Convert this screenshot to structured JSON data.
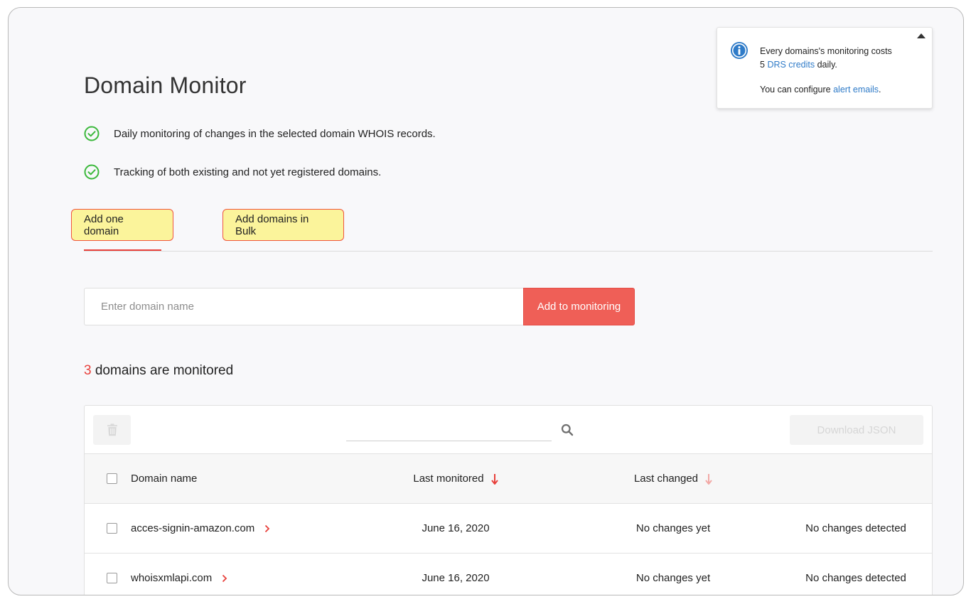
{
  "header": {
    "title": "Domain Monitor"
  },
  "features": [
    "Daily monitoring of changes in the selected domain WHOIS records.",
    "Tracking of both existing and not yet registered domains."
  ],
  "info_box": {
    "line1": "Every domains's monitoring costs",
    "cost_number": "5",
    "credits_link": "DRS credits",
    "cost_suffix": "daily.",
    "configure_prefix": "You can configure",
    "alert_link": "alert emails",
    "configure_suffix": "."
  },
  "tabs": [
    {
      "label": "Add one domain",
      "active": true
    },
    {
      "label": "Add domains in Bulk",
      "active": false
    }
  ],
  "domain_form": {
    "placeholder": "Enter domain name",
    "value": "",
    "submit_label": "Add to monitoring"
  },
  "summary": {
    "count": "3",
    "text": "domains are monitored"
  },
  "table": {
    "search_value": "",
    "download_label": "Download JSON",
    "columns": {
      "domain": "Domain name",
      "last_monitored": "Last monitored",
      "last_changed": "Last changed"
    },
    "rows": [
      {
        "domain": "acces-signin-amazon.com",
        "last_monitored": "June 16, 2020",
        "last_changed": "No changes yet",
        "status": "No changes detected"
      },
      {
        "domain": "whoisxmlapi.com",
        "last_monitored": "June 16, 2020",
        "last_changed": "No changes yet",
        "status": "No changes detected"
      }
    ]
  },
  "colors": {
    "accent_red": "#e8403b",
    "button_red": "#ef5f57",
    "tab_highlight": "#fbf49b",
    "check_green": "#3bb83b",
    "info_blue": "#2f7bc8"
  },
  "icons": {
    "feature": "check-circle-icon",
    "info": "info-icon",
    "collapse": "caret-up-icon",
    "delete": "trash-icon",
    "search": "search-icon",
    "sort": "arrow-down-icon",
    "row_expand": "chevron-right-icon"
  }
}
